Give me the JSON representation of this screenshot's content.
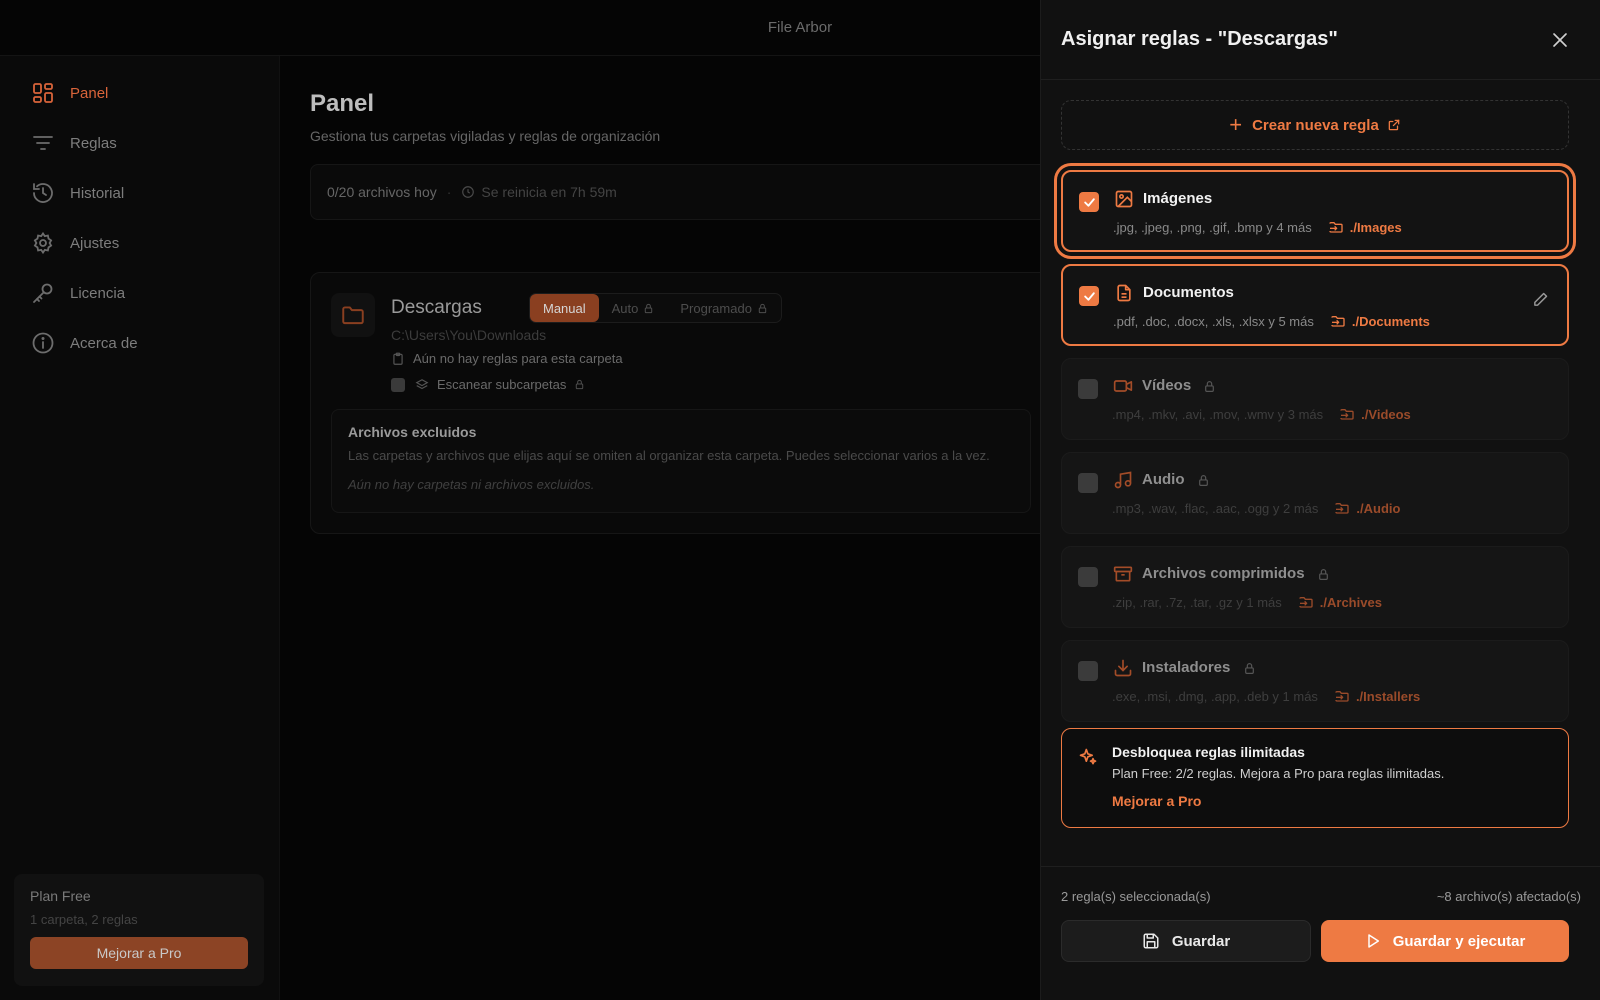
{
  "app": {
    "title": "File Arbor"
  },
  "colors": {
    "accent": "#ee7a43",
    "background": "#050505",
    "panel": "#111111"
  },
  "sidebar": {
    "items": [
      {
        "label": "Panel",
        "icon": "dashboard-icon",
        "active": true
      },
      {
        "label": "Reglas",
        "icon": "filter-icon"
      },
      {
        "label": "Historial",
        "icon": "history-icon"
      },
      {
        "label": "Ajustes",
        "icon": "gear-icon"
      },
      {
        "label": "Licencia",
        "icon": "key-icon"
      },
      {
        "label": "Acerca de",
        "icon": "info-icon"
      }
    ],
    "plan": {
      "title": "Plan Free",
      "subtitle": "1 carpeta, 2 reglas",
      "upgrade_label": "Mejorar a Pro"
    }
  },
  "main": {
    "title": "Panel",
    "subtitle": "Gestiona tus carpetas vigiladas y reglas de organización",
    "usage": {
      "files_today": "0/20 archivos hoy",
      "separator": "·",
      "reset": "Se reinicia en 7h 59m"
    },
    "folder": {
      "name": "Descargas",
      "path": "C:\\Users\\You\\Downloads",
      "modes": [
        "Manual",
        "Auto",
        "Programado"
      ],
      "active_mode": "Manual",
      "no_rules": "Aún no hay reglas para esta carpeta",
      "scan_subfolders": "Escanear subcarpetas",
      "excluded": {
        "title": "Archivos excluidos",
        "description": "Las carpetas y archivos que elijas aquí se omiten al organizar esta carpeta. Puedes seleccionar varios a la vez.",
        "empty": "Aún no hay carpetas ni archivos excluidos."
      }
    }
  },
  "panel": {
    "title": "Asignar reglas - \"Descargas\"",
    "create_rule_label": "Crear nueva regla",
    "rules": [
      {
        "name": "Imágenes",
        "extensions": ".jpg, .jpeg, .png, .gif, .bmp y 4 más",
        "destination": "./Images",
        "selected": true,
        "locked": false,
        "icon": "image-icon"
      },
      {
        "name": "Documentos",
        "extensions": ".pdf, .doc, .docx, .xls, .xlsx y 5 más",
        "destination": "./Documents",
        "selected": true,
        "locked": false,
        "icon": "document-icon"
      },
      {
        "name": "Vídeos",
        "extensions": ".mp4, .mkv, .avi, .mov, .wmv y 3 más",
        "destination": "./Videos",
        "selected": false,
        "locked": true,
        "icon": "video-icon"
      },
      {
        "name": "Audio",
        "extensions": ".mp3, .wav, .flac, .aac, .ogg y 2 más",
        "destination": "./Audio",
        "selected": false,
        "locked": true,
        "icon": "music-icon"
      },
      {
        "name": "Archivos comprimidos",
        "extensions": ".zip, .rar, .7z, .tar, .gz y 1 más",
        "destination": "./Archives",
        "selected": false,
        "locked": true,
        "icon": "archive-icon"
      },
      {
        "name": "Instaladores",
        "extensions": ".exe, .msi, .dmg, .app, .deb y 1 más",
        "destination": "./Installers",
        "selected": false,
        "locked": true,
        "icon": "download-icon"
      }
    ],
    "upsell": {
      "title": "Desbloquea reglas ilimitadas",
      "description": "Plan Free: 2/2 reglas. Mejora a Pro para reglas ilimitadas.",
      "link": "Mejorar a Pro"
    },
    "footer": {
      "selected_count": "2 regla(s) seleccionada(s)",
      "affected": "~8 archivo(s) afectado(s)",
      "save_label": "Guardar",
      "save_run_label": "Guardar y ejecutar"
    }
  }
}
